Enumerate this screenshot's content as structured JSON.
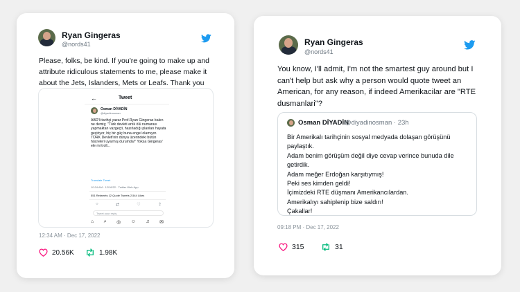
{
  "colors": {
    "twitter_blue": "#1d9bf0",
    "like_red": "#f91880",
    "retweet_green": "#00ba7c"
  },
  "tweet1": {
    "name": "Ryan Gingeras",
    "handle": "@nords41",
    "text": "Please, folks, be kind. If you're going to make up and attribute ridiculous statements to me, please make it about the Jets, Islanders, Mets or Leafs. Thank you",
    "timestamp": "12:34 AM · Dec 17, 2022",
    "likes": "20.56K",
    "retweets": "1.98K",
    "screenshot": {
      "back": "←",
      "title": "Tweet",
      "author_name": "Osman DİYADİN",
      "author_handle": "@diyadinosman",
      "body": "ABD'li tarihçi yazar Prof.Ryan Gingeras bakın ne demiş; \"Türk devleti artık ölü numarası yapmaktan vazgeçti, hazırladığı planları hayata geçiriyor, hiç bir güç buna engel olamıyor. TÜRK Devleti'nin dünya üzerindeki bütün hücreleri uyarmış durumda!\" Yoksa Gingeras' ele mi troll...",
      "translate": "Translate Tweet",
      "time": "10:24 AM · 12/16/22 · Twitter Web App",
      "stats": "551 Retweets  12 Quote Tweets  2,544 Likes",
      "reply_placeholder": "Tweet your reply"
    }
  },
  "tweet2": {
    "name": "Ryan Gingeras",
    "handle": "@nords41",
    "text": "You know, I'll admit, I'm not the smartest guy around but I can't help but ask why  a person would quote tweet an American, for any reason, if indeed Amerikacilar are \"RTE dusmanlari\"?",
    "timestamp": "09:18 PM · Dec 17, 2022",
    "likes": "315",
    "retweets": "31",
    "quote": {
      "name": "Osman DİYADİN",
      "handle": "@diyadinosman · 23h",
      "lines": [
        "Bir Amerikalı tarihçinin sosyal medyada dolaşan görüşünü paylaştık.",
        "Adam benim görüşüm değil diye cevap verince bunuda dile getirdik.",
        "Adam meğer Erdoğan karşıtıymış!",
        "Peki ses kimden geldi!",
        "İçimizdeki RTE düşmanı Amerikancılardan.",
        "Amerikalıyı sahiplenip bize saldırı!",
        "Çakallar!"
      ]
    }
  }
}
